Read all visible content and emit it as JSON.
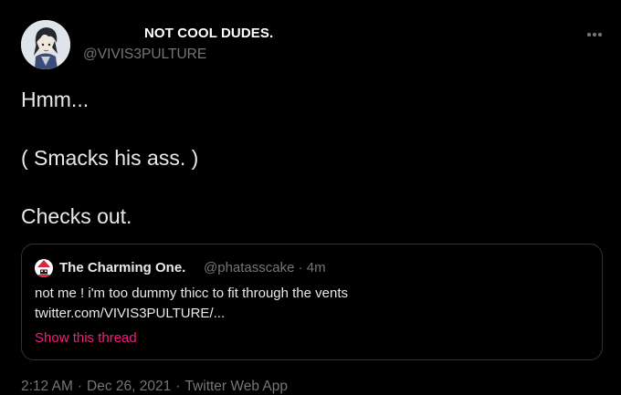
{
  "tweet": {
    "author": {
      "display_name": "NOT COOL DUDES.",
      "handle": "@VIVIS3PULTURE",
      "avatar_icon": "cartoon-character-avatar-icon"
    },
    "more_icon": "more-options-icon",
    "lines": [
      "Hmm...",
      "( Smacks his ass. )",
      "Checks out."
    ],
    "quote": {
      "author_name": "The Charming One.",
      "author_handle": "@phatasscake",
      "separator": "·",
      "time_ago": "4m",
      "avatar_icon": "red-hat-character-avatar-icon",
      "text": "not me ! i'm too dummy thicc to fit through the vents",
      "link": "twitter.com/VIVIS3PULTURE/...",
      "show_thread_label": "Show this thread"
    },
    "footer": {
      "time": "2:12 AM",
      "date": "Dec 26, 2021",
      "source": "Twitter Web App",
      "separator": "·"
    }
  },
  "colors": {
    "background": "#000000",
    "text": "#e7e9ea",
    "secondary_text": "#71767b",
    "border": "#2f3336",
    "accent_pink": "#f91880"
  }
}
